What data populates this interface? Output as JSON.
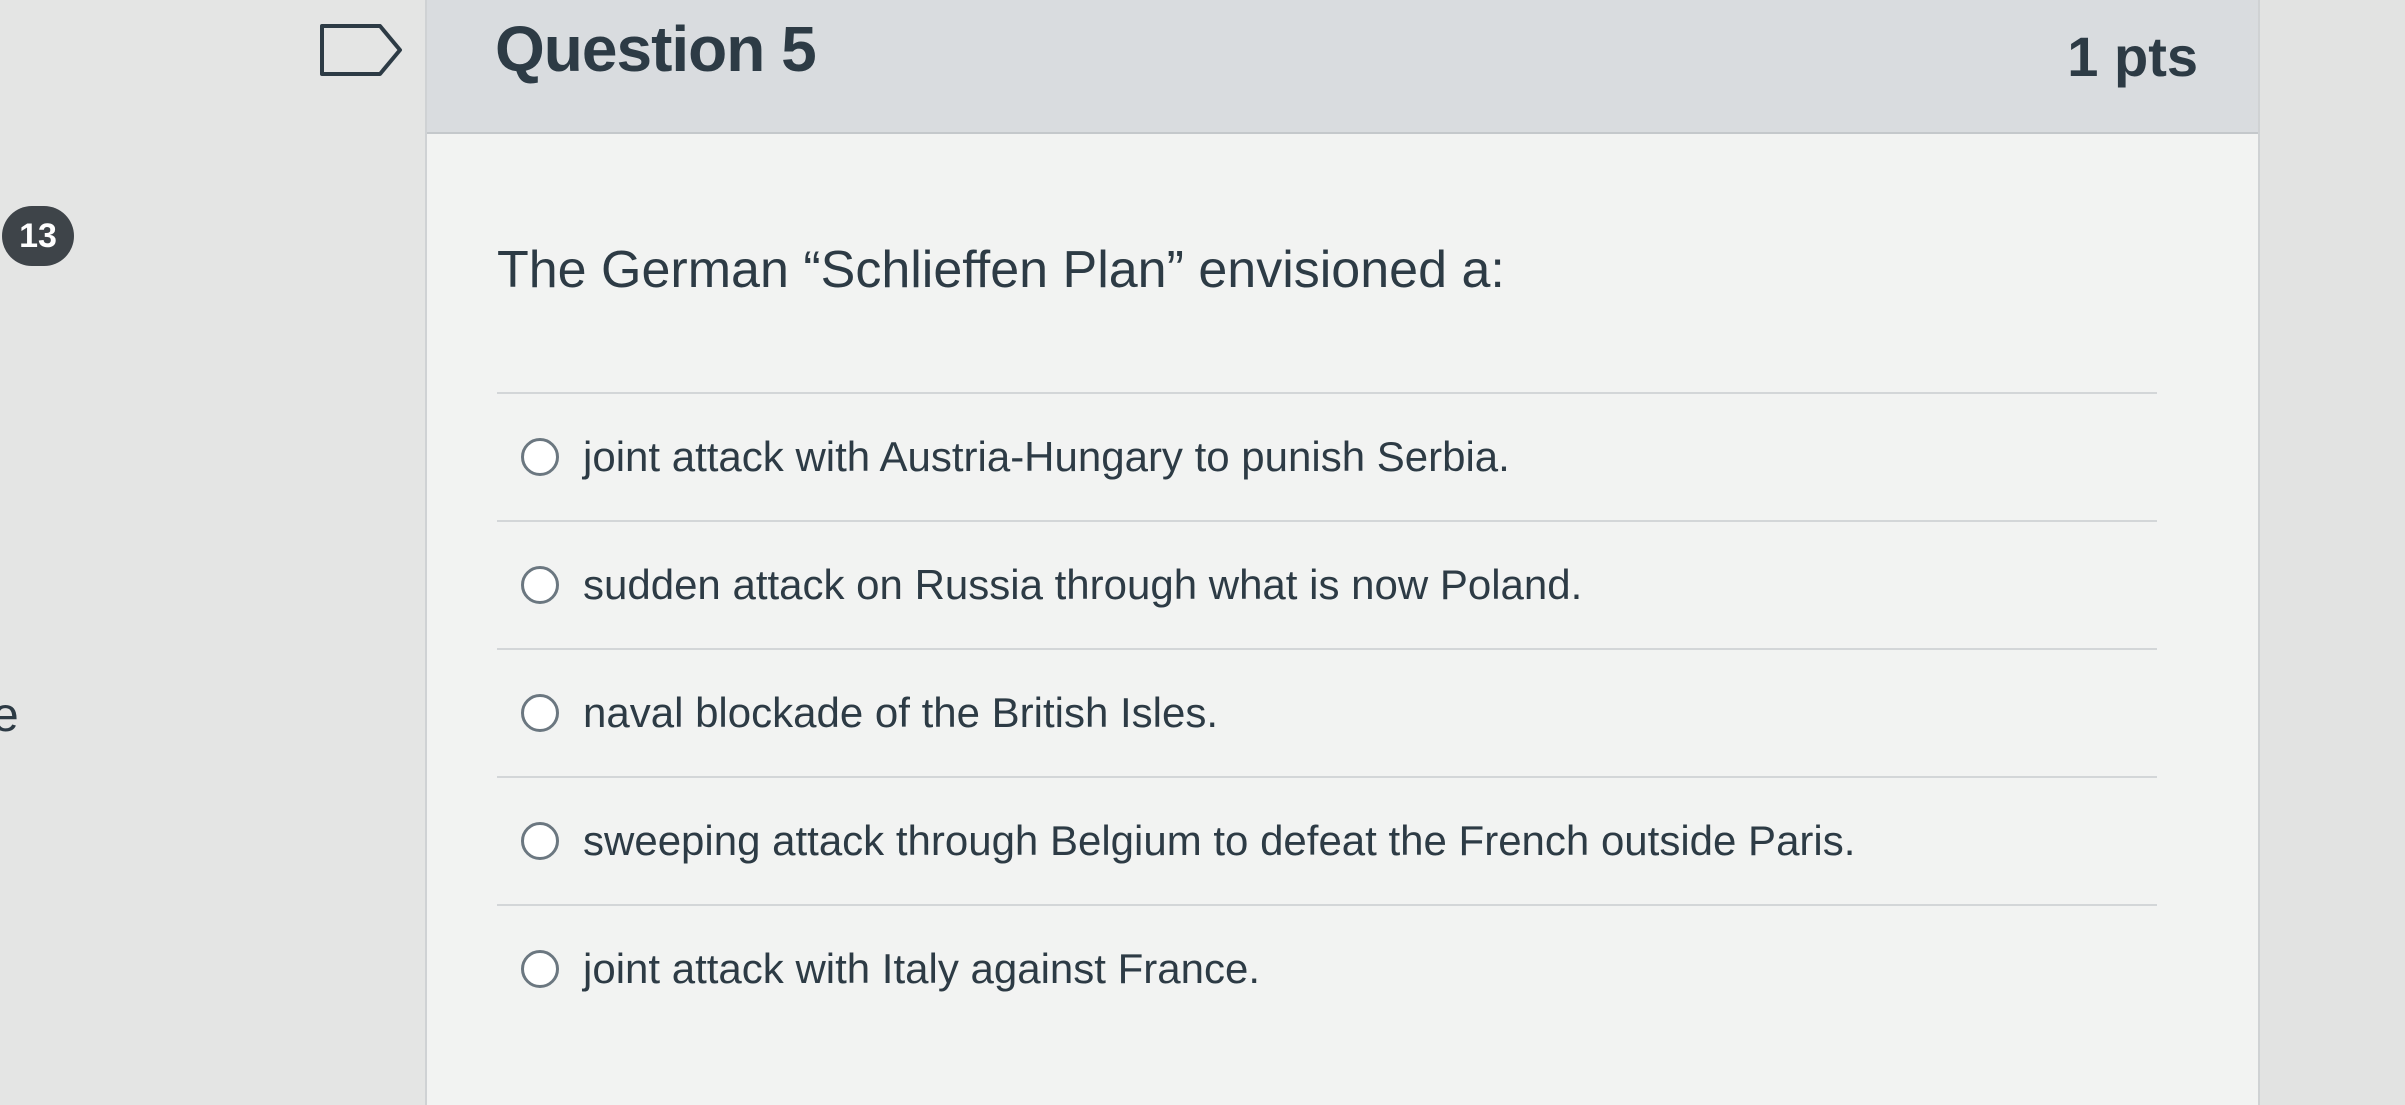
{
  "sidebar": {
    "question_number_badge": "13",
    "fragment_text": "e"
  },
  "question": {
    "title": "Question 5",
    "points": "1 pts",
    "text": "The German “Schlieffen Plan” envisioned a:",
    "answers": [
      {
        "label": "joint attack with Austria-Hungary to punish Serbia."
      },
      {
        "label": "sudden attack on Russia through what is now Poland."
      },
      {
        "label": "naval blockade of the British Isles."
      },
      {
        "label": "sweeping attack through Belgium to defeat the French outside Paris."
      },
      {
        "label": "joint attack with Italy against France."
      }
    ]
  },
  "icons": {
    "flag": "flag-question-icon",
    "radio": "radio-unselected-icon"
  },
  "colors": {
    "text": "#2d3b45",
    "header_bg": "#d9dcdf",
    "card_bg": "#f2f3f2",
    "badge_bg": "#3e4449"
  }
}
